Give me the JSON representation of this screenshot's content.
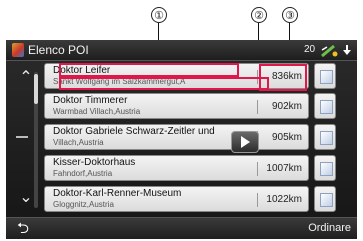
{
  "callouts": [
    "①",
    "②",
    "③"
  ],
  "header": {
    "title": "Elenco POI",
    "count": "20"
  },
  "scroll": {
    "up_glyph": "⌃",
    "down_glyph": "⌄"
  },
  "list": [
    {
      "name": "Doktor Leifer",
      "address": "Sankt Wolfgang im Salzkammergut,A",
      "distance": "836km"
    },
    {
      "name": "Doktor Timmerer",
      "address": "Warmbad Villach,Austria",
      "distance": "902km"
    },
    {
      "name": "Doktor Gabriele Schwarz-Zeitler und",
      "address": "Villach,Austria",
      "distance": "905km"
    },
    {
      "name": "Kisser-Doktorhaus",
      "address": "Fahndorf,Austria",
      "distance": "1007km"
    },
    {
      "name": "Doktor-Karl-Renner-Museum",
      "address": "Gloggnitz,Austria",
      "distance": "1022km"
    }
  ],
  "footer": {
    "back_glyph": "⮌",
    "sort_label": "Ordinare"
  },
  "icons": {
    "title": "poi-list-icon",
    "gps": "gps-signal-icon",
    "download": "down-arrow-icon",
    "map": "map-icon",
    "play": "play-icon",
    "back": "back-icon"
  },
  "colors": {
    "highlight": "#e0174a",
    "row_bg": "#e8e8e8",
    "bar_bg": "#2a2a2a"
  }
}
